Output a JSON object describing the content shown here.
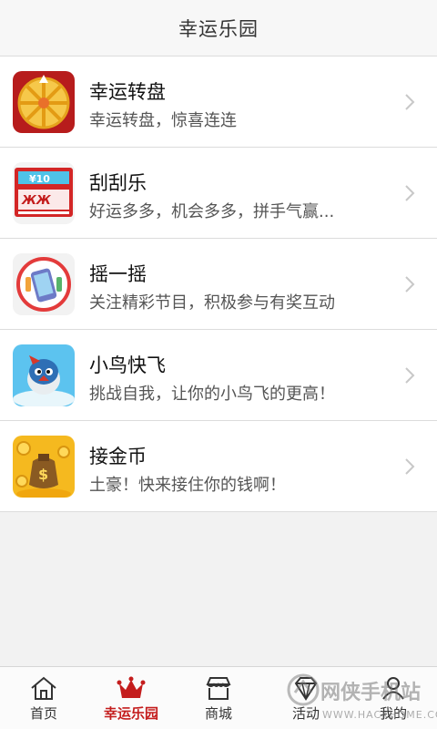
{
  "header": {
    "title": "幸运乐园"
  },
  "games": [
    {
      "name": "幸运转盘",
      "desc": "幸运转盘，惊喜连连",
      "icon": "lucky-wheel-icon"
    },
    {
      "name": "刮刮乐",
      "desc": "好运多多，机会多多，拼手气赢...",
      "icon": "scratch-card-icon"
    },
    {
      "name": "摇一摇",
      "desc": "关注精彩节目，积极参与有奖互动",
      "icon": "shake-phone-icon"
    },
    {
      "name": "小鸟快飞",
      "desc": "挑战自我，让你的小鸟飞的更高！",
      "icon": "bird-icon"
    },
    {
      "name": "接金币",
      "desc": "土豪！快来接住你的钱啊！",
      "icon": "gold-coin-bag-icon"
    }
  ],
  "tabs": [
    {
      "label": "首页",
      "icon": "home-icon"
    },
    {
      "label": "幸运乐园",
      "icon": "crown-icon",
      "active": true
    },
    {
      "label": "商城",
      "icon": "shop-icon"
    },
    {
      "label": "活动",
      "icon": "diamond-icon"
    },
    {
      "label": "我的",
      "icon": "user-icon"
    }
  ],
  "watermark": {
    "text": "网侠手机站",
    "url": "WWW.HACKHOME.COM"
  },
  "colors": {
    "accent": "#c41d1d",
    "divider": "#dcdcdc"
  }
}
